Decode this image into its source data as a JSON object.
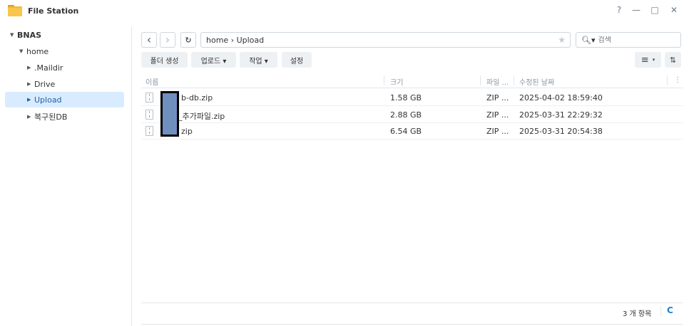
{
  "window": {
    "title": "File Station",
    "help": "?",
    "minimize": "—",
    "maximize": "□",
    "close": "✕"
  },
  "sidebar": {
    "root": "BNAS",
    "home": "home",
    "items": [
      {
        "label": ".Maildir"
      },
      {
        "label": "Drive"
      },
      {
        "label": "Upload"
      },
      {
        "label": "복구된DB"
      }
    ],
    "selected": "Upload"
  },
  "toolbar": {
    "back": "‹",
    "forward": "›",
    "refresh": "↻",
    "path": "home › Upload",
    "star": "★",
    "search_glyph": "🔍︎▾",
    "search_placeholder": "검색",
    "create_folder": "폴더 생성",
    "upload": "업로드 ▾",
    "action": "작업 ▾",
    "settings": "설정",
    "list_view": "≡",
    "view_dropdown": "▾",
    "sort": "⇅"
  },
  "table": {
    "headers": {
      "name": "이름",
      "size": "크기",
      "type": "파일 ...",
      "modified": "수정된 날짜",
      "more": "⋮"
    },
    "rows": [
      {
        "name": "b-db.zip",
        "size": "1.58 GB",
        "type": "ZIP ...",
        "modified": "2025-04-02 18:59:40"
      },
      {
        "name": "_추가파일.zip",
        "size": "2.88 GB",
        "type": "ZIP ...",
        "modified": "2025-03-31 22:29:32"
      },
      {
        "name": "zip",
        "size": "6.54 GB",
        "type": "ZIP ...",
        "modified": "2025-03-31 20:54:38"
      }
    ]
  },
  "footer": {
    "count": "3 개 항목",
    "refresh": "C"
  },
  "colors": {
    "accent": "#1e7fd6",
    "selected_bg": "#d9ecff",
    "folder_icon": "#f5b731"
  }
}
